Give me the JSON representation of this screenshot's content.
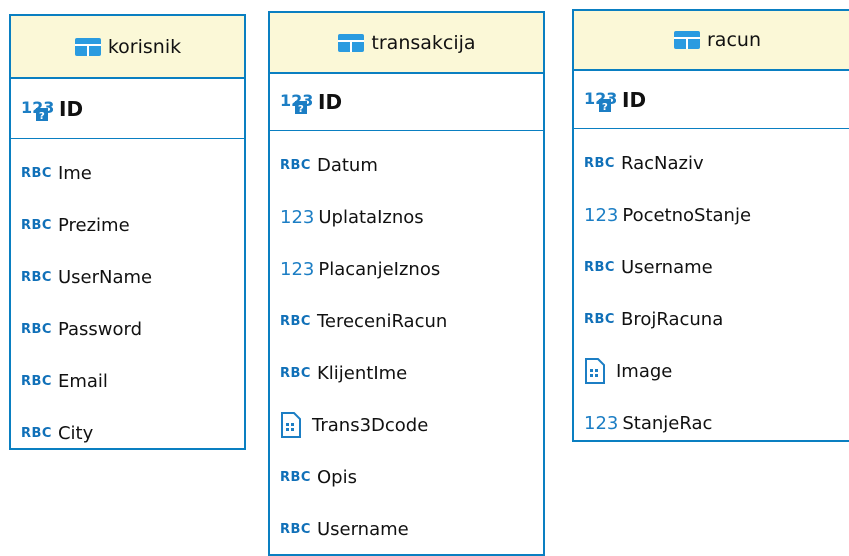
{
  "colors": {
    "border": "#0a7fc1",
    "header_bg": "#fbf8d7",
    "type_text": "#1070b8"
  },
  "icons": {
    "table": "table-icon",
    "pk": "primary-key-icon",
    "blob": "binary-file-icon"
  },
  "entities": [
    {
      "title": "korisnik",
      "pk": {
        "type": "123",
        "name": "ID"
      },
      "fields": [
        {
          "type": "RBC",
          "name": "Ime"
        },
        {
          "type": "RBC",
          "name": "Prezime"
        },
        {
          "type": "RBC",
          "name": "UserName"
        },
        {
          "type": "RBC",
          "name": "Password"
        },
        {
          "type": "RBC",
          "name": "Email"
        },
        {
          "type": "RBC",
          "name": "City"
        }
      ]
    },
    {
      "title": "transakcija",
      "pk": {
        "type": "123",
        "name": "ID"
      },
      "fields": [
        {
          "type": "RBC",
          "name": "Datum"
        },
        {
          "type": "123",
          "name": "UplataIznos"
        },
        {
          "type": "123",
          "name": "PlacanjeIznos"
        },
        {
          "type": "RBC",
          "name": "TereceniRacun"
        },
        {
          "type": "RBC",
          "name": "KlijentIme"
        },
        {
          "type": "blob",
          "name": "Trans3Dcode"
        },
        {
          "type": "RBC",
          "name": "Opis"
        },
        {
          "type": "RBC",
          "name": "Username"
        }
      ]
    },
    {
      "title": "racun",
      "pk": {
        "type": "123",
        "name": "ID"
      },
      "fields": [
        {
          "type": "RBC",
          "name": "RacNaziv"
        },
        {
          "type": "123",
          "name": "PocetnoStanje"
        },
        {
          "type": "RBC",
          "name": "Username"
        },
        {
          "type": "RBC",
          "name": "BrojRacuna"
        },
        {
          "type": "blob",
          "name": "Image"
        },
        {
          "type": "123",
          "name": "StanjeRac"
        }
      ]
    }
  ]
}
